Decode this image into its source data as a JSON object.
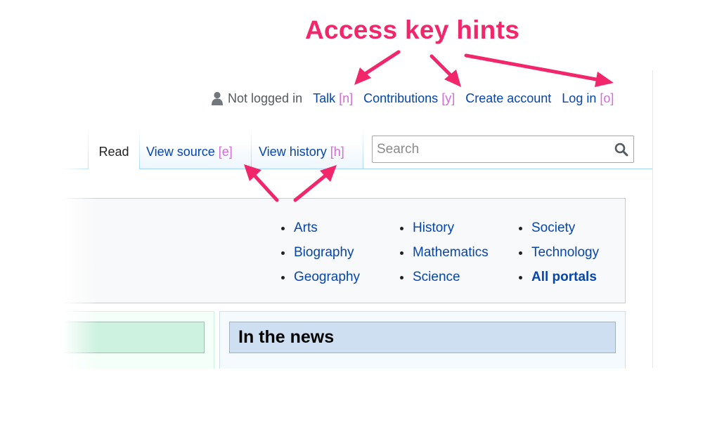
{
  "annotation": {
    "title": "Access key hints",
    "color": "#f2266a"
  },
  "personal_tools": {
    "user_icon": "user-icon",
    "not_logged_in": "Not logged in",
    "talk": {
      "label": "Talk",
      "hint": "[n]"
    },
    "contributions": {
      "label": "Contributions",
      "hint": "[y]"
    },
    "create_account": {
      "label": "Create account"
    },
    "log_in": {
      "label": "Log in",
      "hint": "[o]"
    }
  },
  "tabs": {
    "read": {
      "label": "Read"
    },
    "view_source": {
      "label": "View source",
      "hint": "[e]"
    },
    "view_history": {
      "label": "View history",
      "hint": "[h]"
    }
  },
  "search": {
    "placeholder": "Search",
    "icon": "search-icon"
  },
  "portals": {
    "columns": [
      [
        "Arts",
        "Biography",
        "Geography"
      ],
      [
        "History",
        "Mathematics",
        "Science"
      ],
      [
        "Society",
        "Technology",
        "All portals"
      ]
    ]
  },
  "panes": {
    "news_heading": "In the news"
  },
  "colors": {
    "link": "#0645ad",
    "hint": "#d56bd8",
    "annotation": "#f2266a",
    "news_heading_bg": "#cedff2",
    "featured_heading_bg": "#cef2e0"
  }
}
